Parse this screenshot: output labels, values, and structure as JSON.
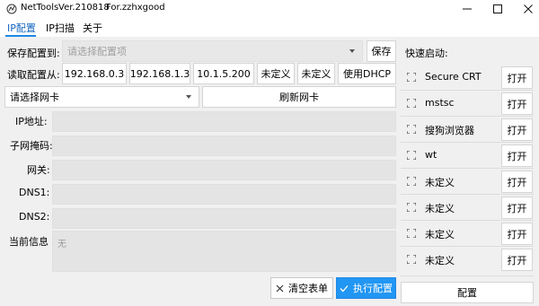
{
  "window": {
    "app_name": "NetTools",
    "version": "Ver.210818",
    "for_text": "For.zzhxgood"
  },
  "tabs": [
    {
      "label": "IP配置",
      "active": true
    },
    {
      "label": "IP扫描",
      "active": false
    },
    {
      "label": "关于",
      "active": false
    }
  ],
  "save_config": {
    "label": "保存配置到:",
    "placeholder": "请选择配置项",
    "button": "保存"
  },
  "load_config": {
    "label": "读取配置从:",
    "presets": [
      "192.168.0.3",
      "192.168.1.3",
      "10.1.5.200",
      "未定义",
      "未定义"
    ],
    "dhcp_button": "使用DHCP"
  },
  "adapter": {
    "select_placeholder": "请选择网卡",
    "refresh_button": "刷新网卡"
  },
  "fields": [
    {
      "label": "IP地址:",
      "value": ""
    },
    {
      "label": "子网掩码:",
      "value": ""
    },
    {
      "label": "网关:",
      "value": ""
    },
    {
      "label": "DNS1:",
      "value": ""
    },
    {
      "label": "DNS2:",
      "value": ""
    }
  ],
  "current_info": {
    "label": "当前信息",
    "value": "无"
  },
  "actions": {
    "clear_label": "清空表单",
    "execute_label": "执行配置"
  },
  "quick_launch": {
    "title": "快速启动:",
    "items": [
      {
        "name": "Secure CRT",
        "open": "打开"
      },
      {
        "name": "mstsc",
        "open": "打开"
      },
      {
        "name": "搜狗浏览器",
        "open": "打开"
      },
      {
        "name": "wt",
        "open": "打开"
      },
      {
        "name": "未定义",
        "open": "打开"
      },
      {
        "name": "未定义",
        "open": "打开"
      },
      {
        "name": "未定义",
        "open": "打开"
      },
      {
        "name": "未定义",
        "open": "打开"
      }
    ],
    "config_button": "配置"
  },
  "colors": {
    "accent": "#2196f3",
    "active_tab": "#1565c0",
    "field_bg": "#e4e4e4"
  }
}
